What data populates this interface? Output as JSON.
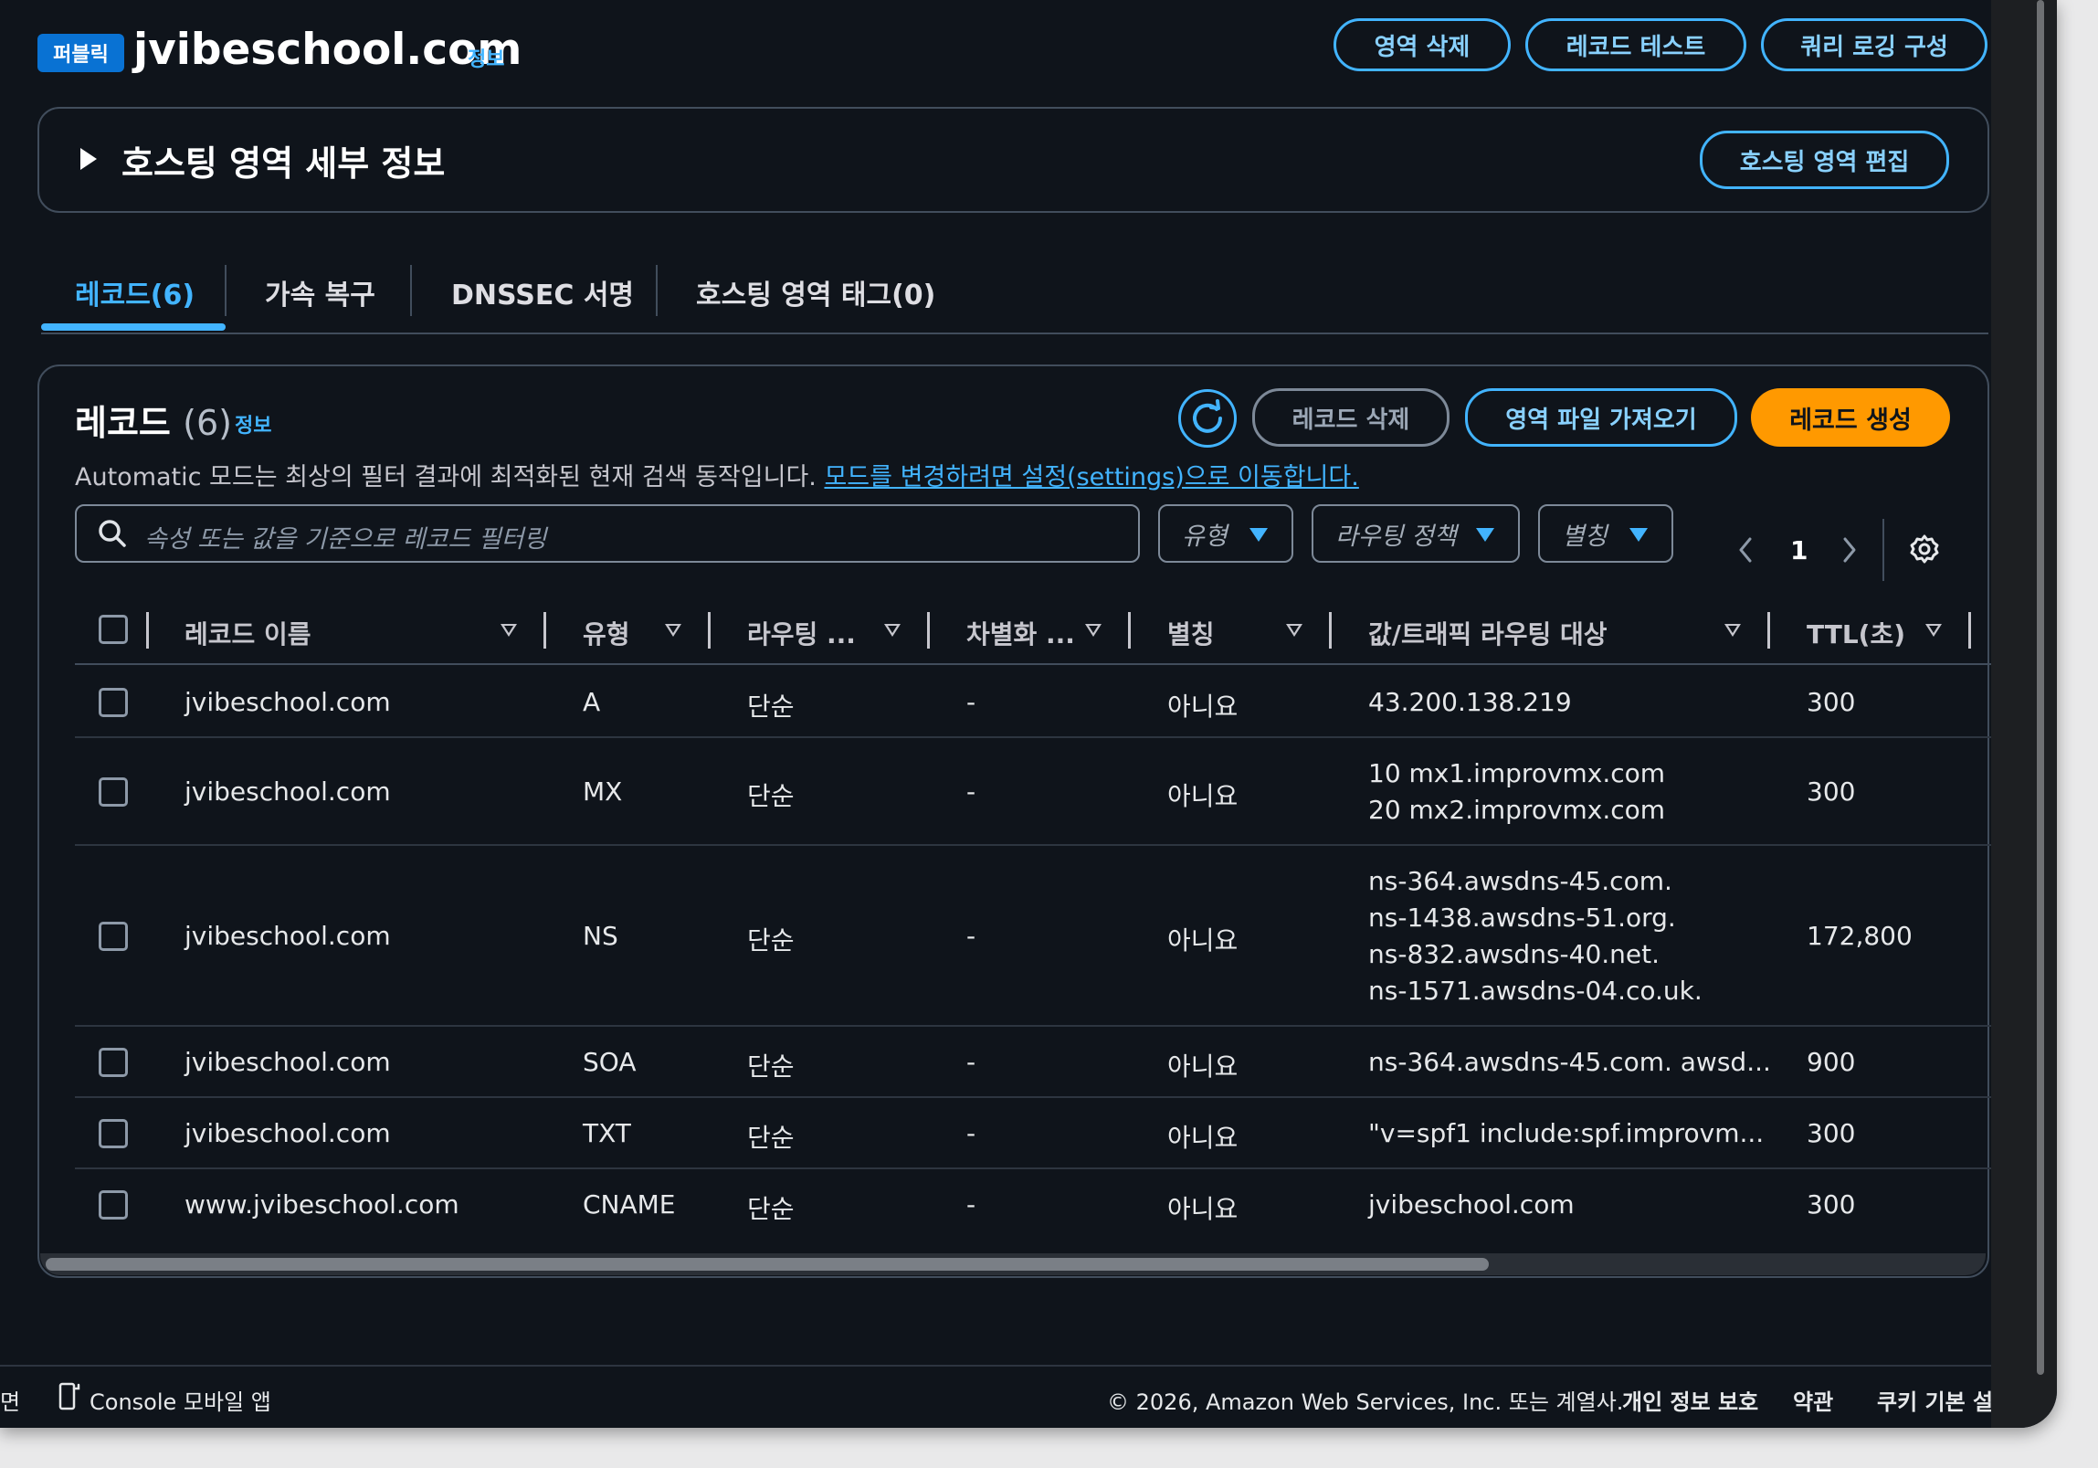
{
  "zone": {
    "badge": "퍼블릭",
    "name": "jvibeschool.com",
    "info": "정보"
  },
  "header_actions": {
    "delete_zone": "영역 삭제",
    "test_record": "레코드 테스트",
    "query_logging": "쿼리 로깅 구성"
  },
  "details": {
    "title": "호스팅 영역 세부 정보",
    "edit": "호스팅 영역 편집"
  },
  "tabs": [
    {
      "label": "레코드(6)",
      "active": true
    },
    {
      "label": "가속 복구"
    },
    {
      "label": "DNSSEC 서명"
    },
    {
      "label": "호스팅 영역 태그(0)"
    }
  ],
  "records": {
    "title": "레코드",
    "count": "(6)",
    "info": "정보",
    "delete": "레코드 삭제",
    "import": "영역 파일 가져오기",
    "create": "레코드 생성",
    "description": "Automatic 모드는 최상의 필터 결과에 최적화된 현재 검색 동작입니다.",
    "description_link": "모드를 변경하려면 설정(settings)으로 이동합니다.",
    "search_placeholder": "속성 또는 값을 기준으로 레코드 필터링",
    "filters": {
      "type": "유형",
      "routing": "라우팅 정책",
      "alias": "별칭"
    },
    "page": "1"
  },
  "columns": [
    "레코드 이름",
    "유형",
    "라우팅 ...",
    "차별화 ...",
    "별칭",
    "값/트래픽 라우팅 대상",
    "TTL(초)"
  ],
  "rows": [
    {
      "name": "jvibeschool.com",
      "type": "A",
      "routing": "단순",
      "diff": "-",
      "alias": "아니요",
      "value": "43.200.138.219",
      "ttl": "300"
    },
    {
      "name": "jvibeschool.com",
      "type": "MX",
      "routing": "단순",
      "diff": "-",
      "alias": "아니요",
      "value": "10 mx1.improvmx.com\n20 mx2.improvmx.com",
      "ttl": "300"
    },
    {
      "name": "jvibeschool.com",
      "type": "NS",
      "routing": "단순",
      "diff": "-",
      "alias": "아니요",
      "value": "ns-364.awsdns-45.com.\nns-1438.awsdns-51.org.\nns-832.awsdns-40.net.\nns-1571.awsdns-04.co.uk.",
      "ttl": "172,800"
    },
    {
      "name": "jvibeschool.com",
      "type": "SOA",
      "routing": "단순",
      "diff": "-",
      "alias": "아니요",
      "value": "ns-364.awsdns-45.com. awsd...",
      "ttl": "900"
    },
    {
      "name": "jvibeschool.com",
      "type": "TXT",
      "routing": "단순",
      "diff": "-",
      "alias": "아니요",
      "value": "\"v=spf1 include:spf.improvm...",
      "ttl": "300"
    },
    {
      "name": "www.jvibeschool.com",
      "type": "CNAME",
      "routing": "단순",
      "diff": "-",
      "alias": "아니요",
      "value": "jvibeschool.com",
      "ttl": "300"
    }
  ],
  "footer": {
    "left_cut": "면",
    "mobile_app": "Console 모바일 앱",
    "copyright": "© 2026, Amazon Web Services, Inc. 또는 계열사.",
    "privacy": "개인 정보 보호",
    "terms": "약관",
    "cookies": "쿠키 기본 설정"
  },
  "colors": {
    "accent": "#42b4ff",
    "primary": "#ff9900",
    "badge": "#0972d3",
    "background": "#0f141b"
  }
}
